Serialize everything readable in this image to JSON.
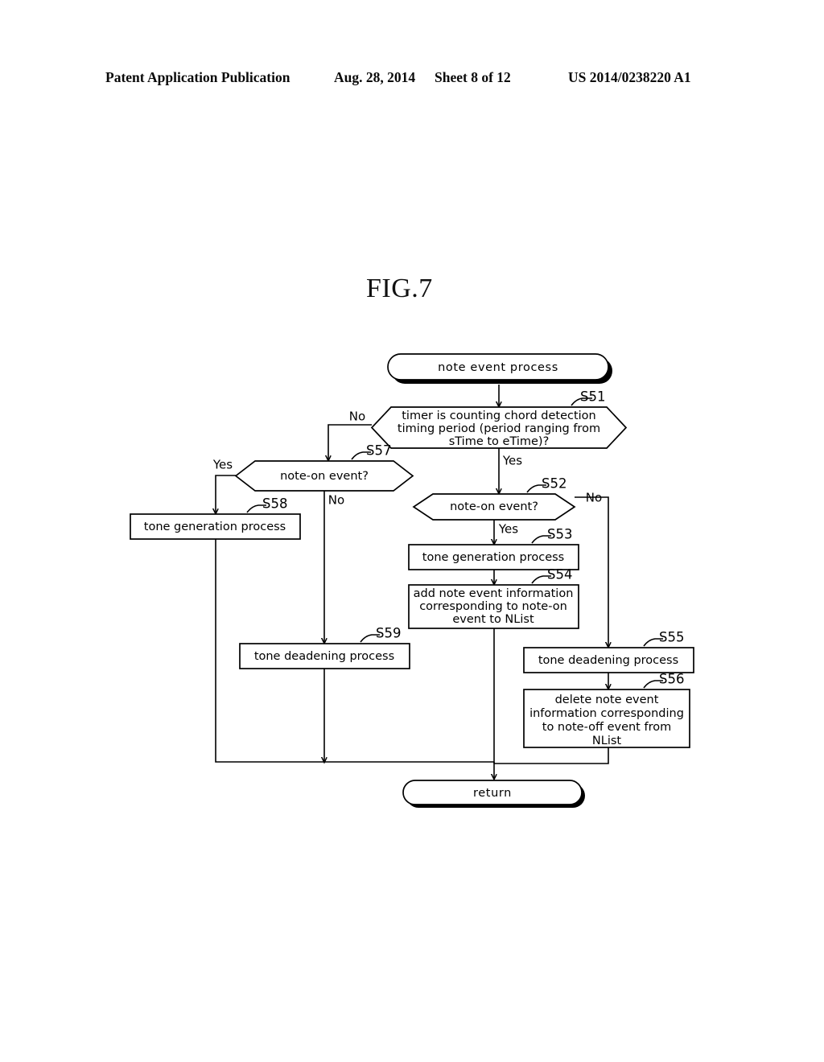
{
  "header": {
    "publication": "Patent Application Publication",
    "date": "Aug. 28, 2014",
    "sheet": "Sheet 8 of 12",
    "patent_number": "US 2014/0238220 A1"
  },
  "figure": {
    "title": "FIG.7"
  },
  "flowchart": {
    "start": {
      "label": "note event process"
    },
    "end": {
      "label": "return"
    },
    "nodes": [
      {
        "id": "S51",
        "step": "S51",
        "type": "decision",
        "text_lines": [
          "timer is counting chord detection",
          "timing period (period ranging from",
          "sTime to eTime)?"
        ]
      },
      {
        "id": "S57",
        "step": "S57",
        "type": "decision",
        "text_lines": [
          "note-on event?"
        ]
      },
      {
        "id": "S58",
        "step": "S58",
        "type": "process",
        "text_lines": [
          "tone generation process"
        ]
      },
      {
        "id": "S52",
        "step": "S52",
        "type": "decision",
        "text_lines": [
          "note-on event?"
        ]
      },
      {
        "id": "S53",
        "step": "S53",
        "type": "process",
        "text_lines": [
          "tone generation process"
        ]
      },
      {
        "id": "S54",
        "step": "S54",
        "type": "process",
        "text_lines": [
          "add note event information",
          "corresponding to note-on",
          "event to NList"
        ]
      },
      {
        "id": "S59",
        "step": "S59",
        "type": "process",
        "text_lines": [
          "tone deadening process"
        ]
      },
      {
        "id": "S55",
        "step": "S55",
        "type": "process",
        "text_lines": [
          "tone deadening process"
        ]
      },
      {
        "id": "S56",
        "step": "S56",
        "type": "process",
        "text_lines": [
          "delete note event",
          "information corresponding",
          "to note-off event from",
          "NList"
        ]
      }
    ],
    "branch_labels": {
      "s51_no": "No",
      "s51_yes": "Yes",
      "s57_yes": "Yes",
      "s57_no": "No",
      "s52_no": "No",
      "s52_yes": "Yes"
    }
  }
}
